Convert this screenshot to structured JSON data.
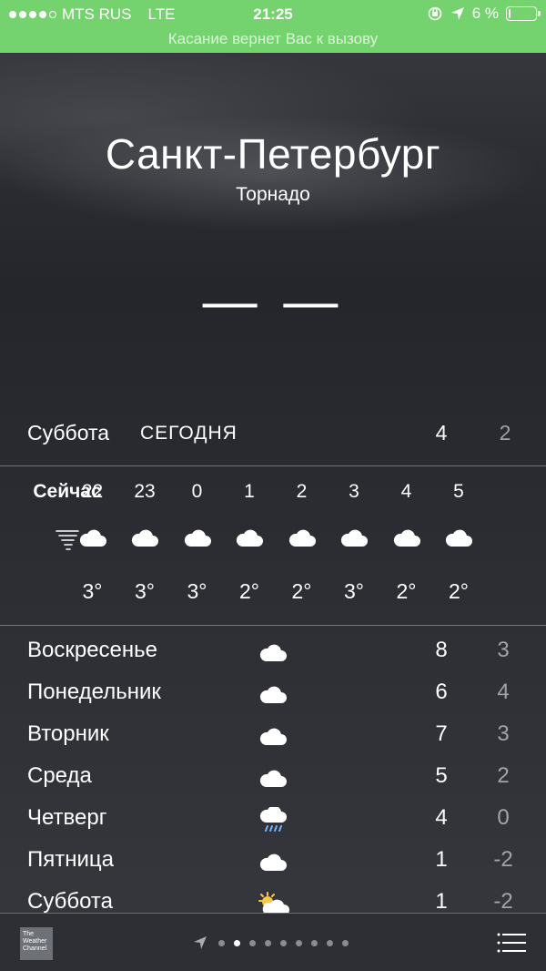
{
  "status_bar": {
    "carrier": "MTS RUS",
    "network": "LTE",
    "time": "21:25",
    "battery_percent": "6 %",
    "battery_level": 0.06,
    "call_banner": "Касание вернет Вас к вызову",
    "accent_color": "#74d36e"
  },
  "weather": {
    "city": "Санкт-Петербург",
    "condition": "Торнадо",
    "current_temp": "— —",
    "today": {
      "day": "Суббота",
      "tag": "СЕГОДНЯ",
      "high": "4",
      "low": "2"
    },
    "hourly": [
      {
        "hour": "Сейчас",
        "icon": "tornado-icon",
        "temp": ""
      },
      {
        "hour": "22",
        "icon": "cloud-icon",
        "temp": "3°"
      },
      {
        "hour": "23",
        "icon": "cloud-icon",
        "temp": "3°"
      },
      {
        "hour": "0",
        "icon": "cloud-icon",
        "temp": "3°"
      },
      {
        "hour": "1",
        "icon": "cloud-icon",
        "temp": "2°"
      },
      {
        "hour": "2",
        "icon": "cloud-icon",
        "temp": "2°"
      },
      {
        "hour": "3",
        "icon": "cloud-icon",
        "temp": "3°"
      },
      {
        "hour": "4",
        "icon": "cloud-icon",
        "temp": "2°"
      },
      {
        "hour": "5",
        "icon": "cloud-icon",
        "temp": "2°"
      }
    ],
    "daily": [
      {
        "day": "Воскресенье",
        "icon": "cloud-icon",
        "high": "8",
        "low": "3"
      },
      {
        "day": "Понедельник",
        "icon": "cloud-icon",
        "high": "6",
        "low": "4"
      },
      {
        "day": "Вторник",
        "icon": "cloud-icon",
        "high": "7",
        "low": "3"
      },
      {
        "day": "Среда",
        "icon": "cloud-icon",
        "high": "5",
        "low": "2"
      },
      {
        "day": "Четверг",
        "icon": "cloud-rain-icon",
        "high": "4",
        "low": "0"
      },
      {
        "day": "Пятница",
        "icon": "cloud-icon",
        "high": "1",
        "low": "-2"
      },
      {
        "day": "Суббота",
        "icon": "partly-sunny-icon",
        "high": "1",
        "low": "-2"
      }
    ]
  },
  "toolbar": {
    "logo_text": "The Weather Channel",
    "page_count": 9,
    "active_page": 1
  }
}
